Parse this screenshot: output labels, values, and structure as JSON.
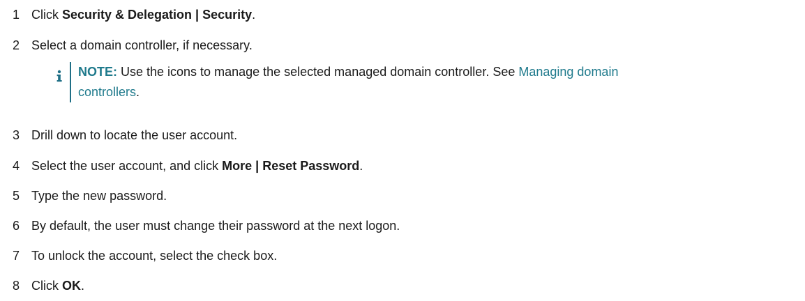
{
  "steps": [
    {
      "num": "1",
      "pre": "Click ",
      "bold": "Security & Delegation | Security",
      "post": "."
    },
    {
      "num": "2",
      "text": "Select a domain controller, if necessary."
    },
    {
      "num": "3",
      "text": "Drill down to locate the user account."
    },
    {
      "num": "4",
      "pre": "Select the user account, and click ",
      "bold": "More | Reset Password",
      "post": "."
    },
    {
      "num": "5",
      "text": "Type the new password."
    },
    {
      "num": "6",
      "text": "By default, the user must change their password at the next logon."
    },
    {
      "num": "7",
      "text": "To unlock the account, select the check box."
    },
    {
      "num": "8",
      "pre": "Click ",
      "bold": "OK",
      "post": "."
    }
  ],
  "note": {
    "icon": "info-icon",
    "label": "NOTE:",
    "text": " Use the icons to manage the selected managed domain controller. See ",
    "link_line1": "Managing domain",
    "link_line2": "controllers",
    "end": ".",
    "label_color": "#1f7a8c",
    "bar_color": "#1f6f86"
  }
}
